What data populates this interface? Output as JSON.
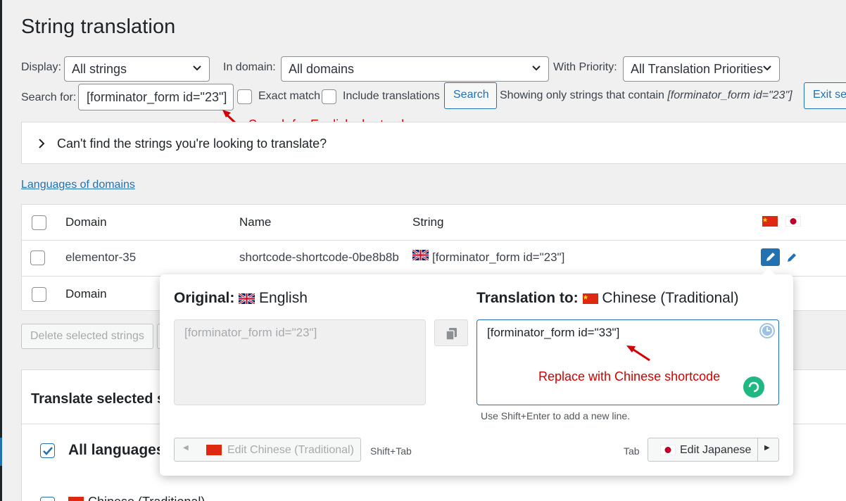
{
  "page": {
    "title": "String translation"
  },
  "filters": {
    "display_label": "Display:",
    "display_value": "All strings",
    "domain_label": "In domain:",
    "domain_value": "All domains",
    "priority_label": "With Priority:",
    "priority_value": "All Translation Priorities",
    "search_label": "Search for:",
    "search_value": "[forminator_form id=\"23\"]",
    "exact_match_label": "Exact match",
    "include_translations_label": "Include translations",
    "search_button": "Search",
    "showing_prefix": "Showing only strings that contain ",
    "showing_term": "[forminator_form id=\"23\"]",
    "exit_search_button": "Exit sea"
  },
  "annotations": {
    "search_note": "Search for English shortcode",
    "replace_note": "Replace with Chinese shortcode"
  },
  "cant_find": {
    "label": "Can't find the strings you're looking to translate?"
  },
  "languages_link": "Languages of domains",
  "table": {
    "headers": {
      "domain": "Domain",
      "name": "Name",
      "string": "String"
    },
    "rows": [
      {
        "domain": "elementor-35",
        "name": "shortcode-shortcode-0be8b8b",
        "string": "[forminator_form id=\"23\"]"
      }
    ],
    "footer_domain": "Domain"
  },
  "bulk": {
    "delete_button": "Delete selected strings",
    "translate_title": "Translate selected s",
    "all_languages_label": "All languages",
    "chinese_label": "Chinese (Traditional)"
  },
  "popup": {
    "original_label": "Original:",
    "original_language": "English",
    "translation_label": "Translation to:",
    "translation_language": "Chinese (Traditional)",
    "original_text": "[forminator_form id=\"23\"]",
    "translation_text": "[forminator_form id=\"33\"]",
    "hint": "Use Shift+Enter to add a new line.",
    "prev_button": "Edit Chinese (Traditional)",
    "prev_shortcut": "Shift+Tab",
    "next_shortcut": "Tab",
    "next_button": "Edit Japanese"
  },
  "colors": {
    "accent": "#2271b1",
    "annotation_red": "#d40000",
    "spinner_green": "#1fb883"
  },
  "icons": [
    "chevron-down-icon",
    "chevron-right-icon",
    "cn-flag-icon",
    "jp-flag-icon",
    "uk-flag-icon",
    "pencil-icon",
    "clock-icon",
    "copy-icon",
    "spinner-icon",
    "arrow-icon"
  ]
}
